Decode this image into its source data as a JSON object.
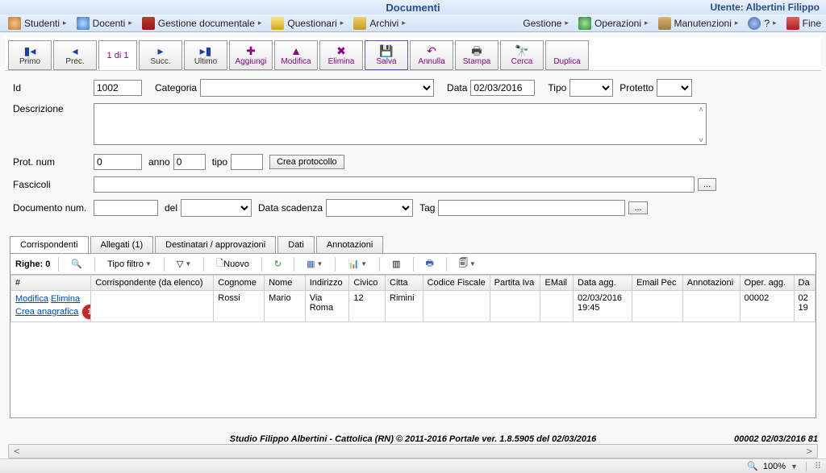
{
  "title": "Documenti",
  "user_label": "Utente: Albertini Filippo",
  "menu": {
    "studenti": "Studenti",
    "docenti": "Docenti",
    "gestione_doc": "Gestione documentale",
    "questionari": "Questionari",
    "archivi": "Archivi",
    "gestione": "Gestione",
    "operazioni": "Operazioni",
    "manutenzioni": "Manutenzioni",
    "help": "?",
    "fine": "Fine"
  },
  "toolbar": {
    "primo": "Primo",
    "prec": "Prec.",
    "page": "1 di 1",
    "succ": "Succ.",
    "ultimo": "Ultimo",
    "aggiungi": "Aggiungi",
    "modifica": "Modifica",
    "elimina": "Elimina",
    "salva": "Salva",
    "annulla": "Annulla",
    "stampa": "Stampa",
    "cerca": "Cerca",
    "duplica": "Duplica"
  },
  "form": {
    "id_label": "Id",
    "id_value": "1002",
    "categoria_label": "Categoria",
    "categoria_value": "",
    "data_label": "Data",
    "data_value": "02/03/2016",
    "tipo_label": "Tipo",
    "tipo_value": "",
    "protetto_label": "Protetto",
    "protetto_value": "",
    "descrizione_label": "Descrizione",
    "descrizione_value": "",
    "protnum_label": "Prot. num",
    "protnum_value": "0",
    "anno_label": "anno",
    "anno_value": "0",
    "tipo2_label": "tipo",
    "tipo2_value": "",
    "crea_protocollo": "Crea protocollo",
    "fascicoli_label": "Fascicoli",
    "fascicoli_value": "",
    "docnum_label": "Documento num.",
    "docnum_value": "",
    "del_label": "del",
    "del_value": "",
    "scadenza_label": "Data scadenza",
    "scadenza_value": "",
    "tag_label": "Tag",
    "tag_value": "",
    "dots": "..."
  },
  "tabs": {
    "corrispondenti": "Corrispondenti",
    "allegati": "Allegati (1)",
    "destinatari": "Destinatari / approvazioni",
    "dati": "Dati",
    "annotazioni": "Annotazioni"
  },
  "grid_toolbar": {
    "righe_label": "Righe:",
    "righe_value": "0",
    "tipo_filtro": "Tipo filtro",
    "nuovo": "Nuovo"
  },
  "grid": {
    "headers": {
      "hash": "#",
      "corrispondente": "Corrispondente (da elenco)",
      "cognome": "Cognome",
      "nome": "Nome",
      "indirizzo": "Indirizzo",
      "civico": "Civico",
      "citta": "Citta",
      "cf": "Codice Fiscale",
      "piva": "Partita Iva",
      "email": "EMail",
      "dataagg": "Data agg.",
      "emailpec": "Email Pec",
      "annotazioni": "Annotazioni",
      "operagg": "Oper. agg.",
      "da": "Da"
    },
    "row_actions": {
      "modifica": "Modifica",
      "elimina": "Elimina",
      "crea_anagrafica": "Crea anagrafica"
    },
    "rows": [
      {
        "cognome": "Rossi",
        "nome": "Mario",
        "indirizzo": "Via Roma",
        "civico": "12",
        "citta": "Rimini",
        "cf": "",
        "piva": "",
        "email": "",
        "dataagg": "02/03/2016 19:45",
        "emailpec": "",
        "annotazioni": "",
        "operagg": "00002",
        "da": "02  19"
      }
    ],
    "badge": "1"
  },
  "footer": {
    "text": "Studio Filippo Albertini - Cattolica (RN) © 2011-2016     Portale ver. 1.8.5905 del 02/03/2016",
    "right": "00002   02/03/2016   81"
  },
  "status": {
    "zoom": "100%"
  }
}
